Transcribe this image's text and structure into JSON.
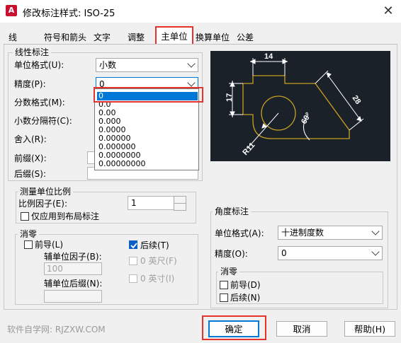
{
  "window": {
    "title": "修改标注样式: ISO-25",
    "app_icon_letter": "A",
    "close_glyph": "✕"
  },
  "tabs": [
    {
      "label": "线",
      "active": false
    },
    {
      "label": "符号和箭头",
      "active": false
    },
    {
      "label": "文字",
      "active": false
    },
    {
      "label": "调整",
      "active": false
    },
    {
      "label": "主单位",
      "active": true
    },
    {
      "label": "换算单位",
      "active": false
    },
    {
      "label": "公差",
      "active": false
    }
  ],
  "linear": {
    "group_label": "线性标注",
    "unit_format": {
      "label": "单位格式(U):",
      "value": "小数"
    },
    "precision": {
      "label": "精度(P):",
      "value": "0"
    },
    "fraction_format": {
      "label": "分数格式(M):"
    },
    "decimal_separator": {
      "label": "小数分隔符(C):"
    },
    "roundoff": {
      "label": "舍入(R):"
    },
    "prefix": {
      "label": "前缀(X):",
      "value": ""
    },
    "suffix": {
      "label": "后缀(S):",
      "value": ""
    },
    "precision_options": [
      "0",
      "0.0",
      "0.00",
      "0.000",
      "0.0000",
      "0.00000",
      "0.000000",
      "0.0000000",
      "0.00000000"
    ],
    "precision_selected_index": 0
  },
  "scale": {
    "group_label": "测量单位比例",
    "factor_label": "比例因子(E):",
    "factor_value": "1",
    "layout_only_label": "仅应用到布局标注",
    "layout_only_checked": false
  },
  "zero_suppress": {
    "group_label": "消零",
    "leading_label": "前导(L)",
    "leading_checked": false,
    "trailing_label": "后续(T)",
    "trailing_checked": true,
    "sub_factor_label": "辅单位因子(B):",
    "sub_factor_value": "100",
    "sub_suffix_label": "辅单位后缀(N):",
    "feet_label": "0 英尺(F)",
    "inches_label": "0 英寸(I)"
  },
  "angular": {
    "group_label": "角度标注",
    "unit_format_label": "单位格式(A):",
    "unit_format_value": "十进制度数",
    "precision_label": "精度(O):",
    "precision_value": "0",
    "zero_group_label": "消零",
    "leading_label": "前导(D)",
    "trailing_label": "后续(N)"
  },
  "preview": {
    "dim_top": "14",
    "dim_left": "17",
    "dim_diag": "28",
    "dim_angle": "60°",
    "dim_radius": "R11",
    "line_color": "#c8a020",
    "dim_color": "#ffffff"
  },
  "buttons": {
    "ok": "确定",
    "cancel": "取消",
    "help": "帮助(H)"
  },
  "watermark": "软件自学网: RJZXW.COM",
  "colors": {
    "highlight": "#e5322d",
    "selection": "#0078d7",
    "preview_bg": "#1b2129"
  }
}
